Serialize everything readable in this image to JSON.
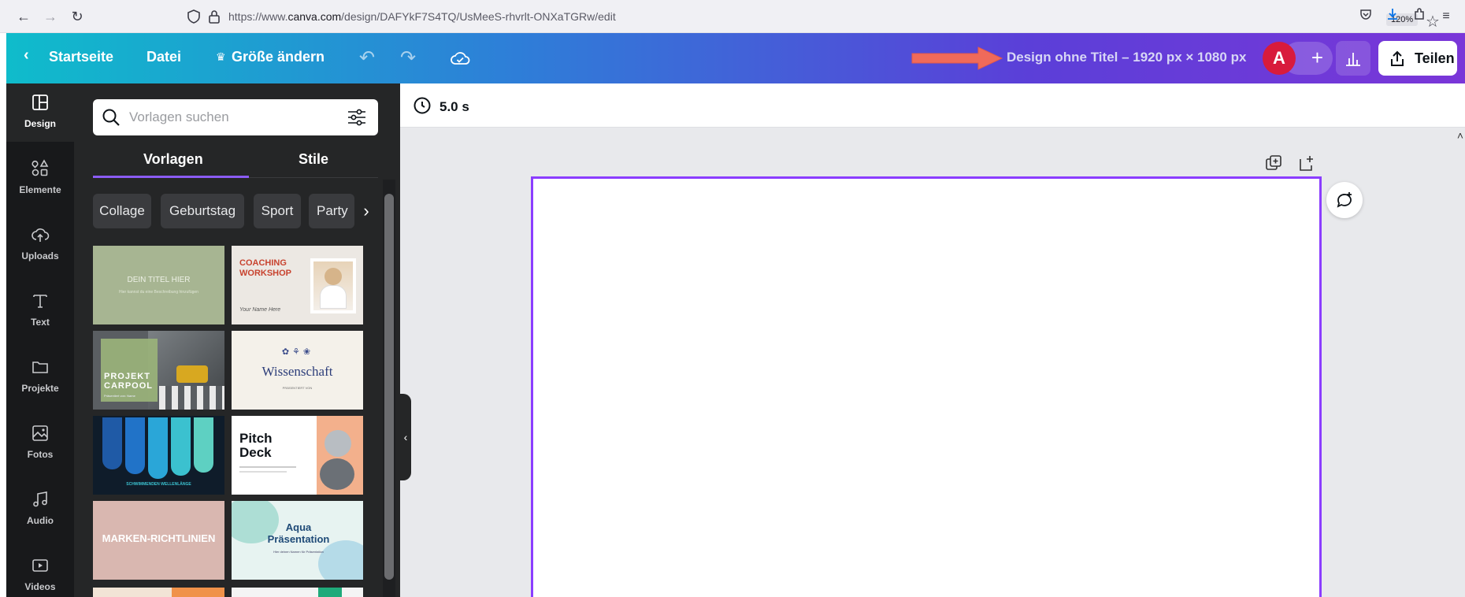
{
  "browser": {
    "url_prefix": "https://www.",
    "url_domain": "canva.com",
    "url_path": "/design/DAFYkF7S4TQ/UsMeeS-rhvrlt-ONXaTGRw/edit",
    "zoom": "120%"
  },
  "topbar": {
    "home_label": "Startseite",
    "file_label": "Datei",
    "resize_label": "Größe ändern",
    "design_title": "Design ohne Titel – 1920 px × 1080 px",
    "avatar_initial": "A",
    "share_label": "Teilen",
    "gradient_colors": [
      "#0fbccb",
      "#2e7ed8",
      "#5b3fd8",
      "#7a36d8"
    ]
  },
  "rail": {
    "items": [
      {
        "label": "Design",
        "icon": "layout-icon"
      },
      {
        "label": "Elemente",
        "icon": "shapes-icon"
      },
      {
        "label": "Uploads",
        "icon": "cloud-upload-icon"
      },
      {
        "label": "Text",
        "icon": "text-icon"
      },
      {
        "label": "Projekte",
        "icon": "folder-icon"
      },
      {
        "label": "Fotos",
        "icon": "image-icon"
      },
      {
        "label": "Audio",
        "icon": "music-icon"
      },
      {
        "label": "Videos",
        "icon": "video-icon"
      }
    ]
  },
  "panel": {
    "search_placeholder": "Vorlagen suchen",
    "tabs": [
      "Vorlagen",
      "Stile"
    ],
    "chips": [
      "Collage",
      "Geburtstag",
      "Sport",
      "Party"
    ],
    "templates": [
      {
        "title": "DEIN TITEL HIER",
        "subtitle": "Hier kannst du eine Beschreibung hinzufügen"
      },
      {
        "title": "COACHING WORKSHOP",
        "subtitle": "Your Name Here"
      },
      {
        "title": "PROJEKT CARPOOL",
        "subtitle": "Präsentiert von: Name"
      },
      {
        "title": "Wissenschaft",
        "subtitle": "PRÄSENTIERT VON"
      },
      {
        "title": "SCHWIMMENDEN WELLENLÄNGE",
        "subtitle": ""
      },
      {
        "title": "Pitch Deck",
        "subtitle": ""
      },
      {
        "title": "MARKEN-RICHTLINIEN",
        "subtitle": ""
      },
      {
        "title": "Aqua Präsentation",
        "subtitle": "Hier deinen Namen für Präsentation"
      }
    ]
  },
  "editor": {
    "duration": "5.0 s",
    "accent": "#8b3dff"
  }
}
